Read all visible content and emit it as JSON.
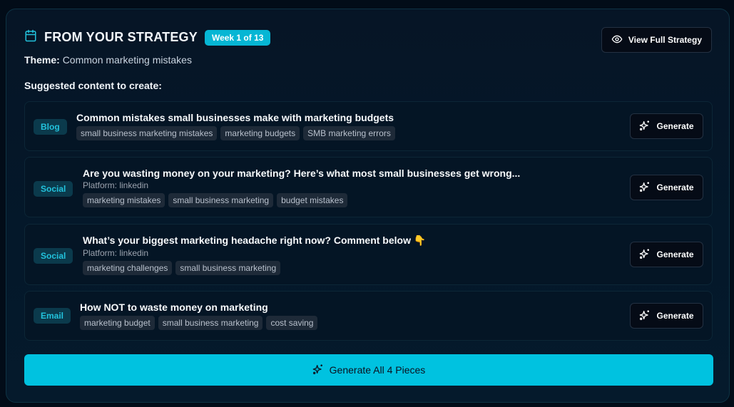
{
  "header": {
    "title": "FROM YOUR STRATEGY",
    "week_badge": "Week 1 of 13",
    "theme_label": "Theme:",
    "theme_value": "Common marketing mistakes",
    "view_button": "View Full Strategy"
  },
  "section_label": "Suggested content to create:",
  "items": [
    {
      "type": "Blog",
      "title": "Common mistakes small businesses make with marketing budgets",
      "platform": null,
      "tags": [
        "small business marketing mistakes",
        "marketing budgets",
        "SMB marketing errors"
      ],
      "button": "Generate"
    },
    {
      "type": "Social",
      "title": "Are you wasting money on your marketing? Here’s what most small businesses get wrong...",
      "platform": "Platform: linkedin",
      "tags": [
        "marketing mistakes",
        "small business marketing",
        "budget mistakes"
      ],
      "button": "Generate"
    },
    {
      "type": "Social",
      "title": "What’s your biggest marketing headache right now? Comment below 👇",
      "platform": "Platform: linkedin",
      "tags": [
        "marketing challenges",
        "small business marketing"
      ],
      "button": "Generate"
    },
    {
      "type": "Email",
      "title": "How NOT to waste money on marketing",
      "platform": null,
      "tags": [
        "marketing budget",
        "small business marketing",
        "cost saving"
      ],
      "button": "Generate"
    }
  ],
  "generate_all": "Generate All 4 Pieces",
  "colors": {
    "accent": "#00c2e0",
    "badge_bg": "#0b3a4c",
    "background": "#020c18"
  }
}
